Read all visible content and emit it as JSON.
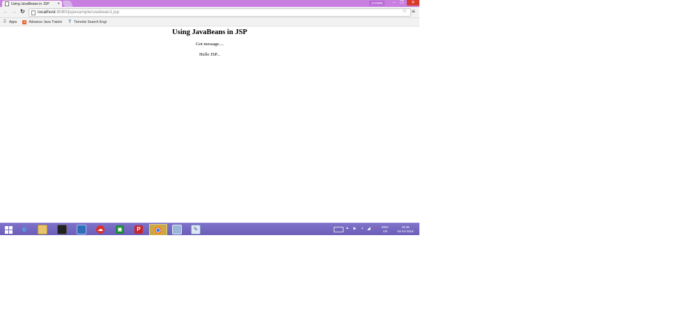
{
  "browser": {
    "tab_title": "Using JavaBeans in JSP",
    "user_badge": "JAYMIN",
    "url_host": "localhost",
    "url_rest": ":8080/jspexample/usebean1.jsp"
  },
  "bookmarks": [
    {
      "label": "Apps",
      "icon": "apps-grid-icon"
    },
    {
      "label": "Advance Java Trainin",
      "icon": "blogger-icon"
    },
    {
      "label": "Torrentz Search Engi",
      "icon": "torrentz-icon"
    }
  ],
  "page": {
    "heading": "Using JavaBeans in JSP",
    "line1": "Got message....",
    "line2": "Hello JSP..."
  },
  "taskbar": {
    "apps": [
      "start",
      "internet-explorer",
      "file-explorer",
      "terminal",
      "remote-desktop",
      "cloud-app",
      "excel-app",
      "pdf-app",
      "chrome",
      "virtualbox",
      "notepad"
    ],
    "lang_top": "ENG",
    "lang_bottom": "US",
    "time": "18:45",
    "date": "04-04-2016"
  },
  "colors": {
    "titlebar": "#c97fe0",
    "taskbar": "#7f72c9",
    "close_button": "#d93b2b"
  }
}
